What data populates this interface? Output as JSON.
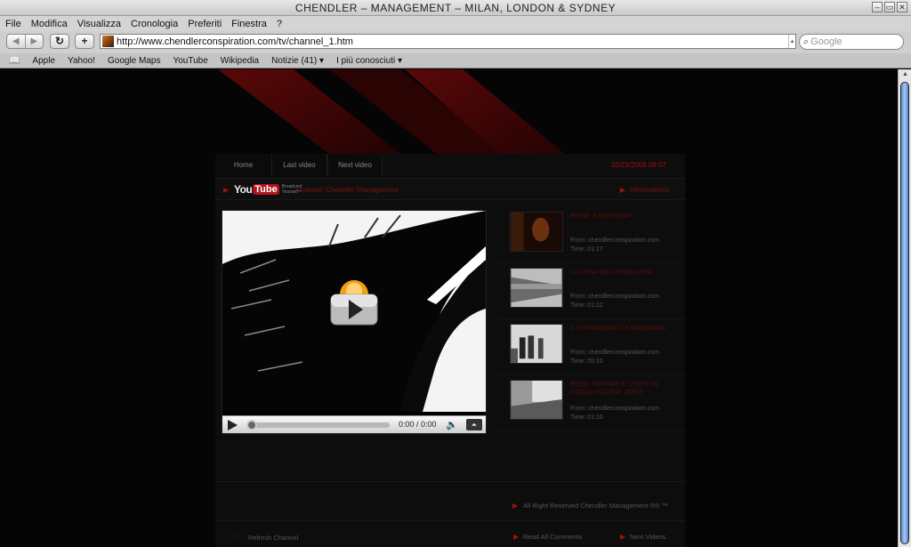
{
  "window": {
    "title": "CHENDLER – MANAGEMENT – MILAN, LONDON & SYDNEY"
  },
  "menu": [
    "File",
    "Modifica",
    "Visualizza",
    "Cronologia",
    "Preferiti",
    "Finestra",
    "?"
  ],
  "toolbar": {
    "back": "◀",
    "forward": "▶",
    "reload": "↻",
    "add": "+",
    "url": "http://www.chendlerconspiration.com/tv/channel_1.htm",
    "search_placeholder": "Google"
  },
  "bookmarks": [
    "Apple",
    "Yahoo!",
    "Google Maps",
    "YouTube",
    "Wikipedia",
    "Notizie (41) ▾",
    "I più conosciuti ▾"
  ],
  "site": {
    "nav": [
      "Home",
      "Last video",
      "Next video"
    ],
    "datetime": "10/23/2008 09:07",
    "youtube_you": "You",
    "youtube_tube": "Tube",
    "youtube_tag": "Broadcast Yourself™",
    "channel": "Channel: Chendler Management",
    "information": "Informations",
    "player": {
      "time": "0:00 / 0:00"
    },
    "videos": [
      {
        "title": "ROSE' S BIRTHDAY",
        "from": "From: chendlerconspiration.com",
        "time": "Time: 01:17"
      },
      {
        "title": "LA CENA DEI CONIGLIONI",
        "from": "From: chendlerconspiration.com",
        "time": "Time: 01:12"
      },
      {
        "title": "IL MATRIMONIO DI MARIANNA",
        "from": "From: chendlerconspiration.com",
        "time": "Time: 05:10"
      },
      {
        "title": "ROSE, NATHAN E STEFY IN CONGIUNZIONE ZERO",
        "from": "From: chendlerconspiration.com",
        "time": "Time: 01:10"
      }
    ],
    "refresh": "Refresh Channel",
    "read_comments": "Read All Comments",
    "next_videos": "Next Videos",
    "copyright": "All Right Reserved Chendler Management ®® ™"
  }
}
